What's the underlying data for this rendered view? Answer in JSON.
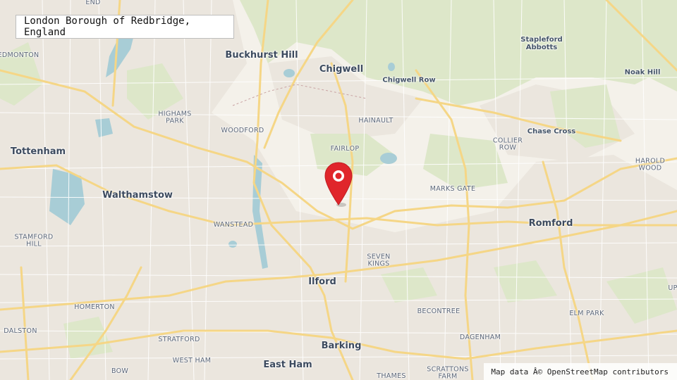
{
  "title": "London Borough of Redbridge, England",
  "attribution": "Map data Â© OpenStreetMap contributors",
  "marker": {
    "icon": "map-pin-icon",
    "color": "#e0262b"
  },
  "colors": {
    "land": "#f4f1ea",
    "urban": "#ebe7df",
    "green": "#dfe8cc",
    "water": "#a9cfd8",
    "major_road": "#f6d98a",
    "minor_road": "#ffffff"
  },
  "places": {
    "end": "END",
    "edmonton": "EDMONTON",
    "buckhurst_hill": "Buckhurst Hill",
    "chigwell": "Chigwell",
    "chigwell_row": "Chigwell Row",
    "stapleford_abbotts": "Stapleford\nAbbotts",
    "noak_hill": "Noak Hill",
    "highams_park": "HIGHAMS\nPARK",
    "woodford": "WOODFORD",
    "hainault": "HAINAULT",
    "tottenham": "Tottenham",
    "fairlop": "FAIRLOP",
    "collier_row": "COLLIER\nROW",
    "chase_cross": "Chase Cross",
    "harold_wood": "HAROLD\nWOOD",
    "walthamstow": "Walthamstow",
    "marks_gate": "MARKS GATE",
    "wanstead": "WANSTEAD",
    "romford": "Romford",
    "stamford_hill": "STAMFORD\nHILL",
    "seven_kings": "SEVEN\nKINGS",
    "ilford": "Ilford",
    "homerton": "HOMERTON",
    "becontree": "BECONTREE",
    "elm_park": "ELM PARK",
    "upminster": "UP",
    "dalston": "DALSTON",
    "stratford": "STRATFORD",
    "dagenham": "DAGENHAM",
    "barking": "Barking",
    "west_ham": "WEST HAM",
    "east_ham": "East Ham",
    "bow": "BOW",
    "thames": "THAMES",
    "scrattons_farm": "SCRATTONS\nFARM"
  }
}
